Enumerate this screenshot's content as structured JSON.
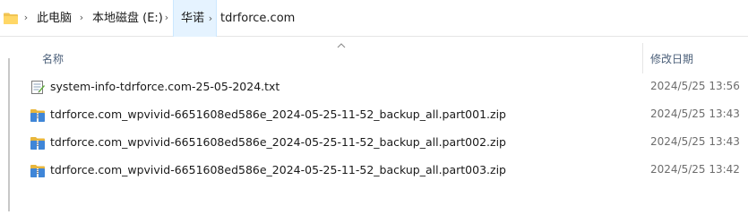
{
  "breadcrumb": {
    "items": [
      "此电脑",
      "本地磁盘 (E:)",
      "华诺",
      "tdrforce.com"
    ],
    "separator": "›"
  },
  "columns": {
    "name": "名称",
    "date": "修改日期"
  },
  "files": [
    {
      "name": "system-info-tdrforce.com-25-05-2024.txt",
      "date": "2024/5/25 13:56",
      "icon": "text-file-icon"
    },
    {
      "name": "tdrforce.com_wpvivid-6651608ed586e_2024-05-25-11-52_backup_all.part001.zip",
      "date": "2024/5/25 13:43",
      "icon": "zip-file-icon"
    },
    {
      "name": "tdrforce.com_wpvivid-6651608ed586e_2024-05-25-11-52_backup_all.part002.zip",
      "date": "2024/5/25 13:43",
      "icon": "zip-file-icon"
    },
    {
      "name": "tdrforce.com_wpvivid-6651608ed586e_2024-05-25-11-52_backup_all.part003.zip",
      "date": "2024/5/25 13:42",
      "icon": "zip-file-icon"
    }
  ],
  "colors": {
    "active_crumb_bg": "#e5f3ff",
    "header_text": "#4c607a",
    "date_text": "#6d6d6d"
  }
}
